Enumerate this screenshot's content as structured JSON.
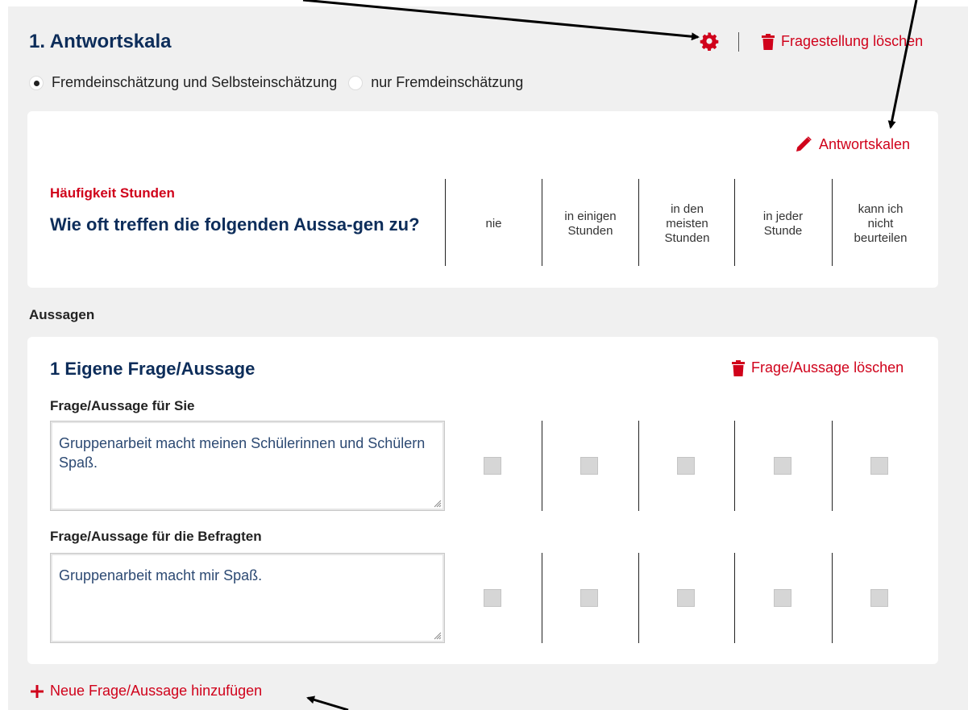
{
  "section": {
    "title": "1. Antwortskala",
    "delete_label": "Fragestellung löschen",
    "radios": [
      {
        "label": "Fremdeinschätzung und Selbsteinschätzung",
        "checked": true
      },
      {
        "label": "nur Fremdeinschätzung",
        "checked": false
      }
    ]
  },
  "scale_card": {
    "edit_label": "Antwortskalen",
    "category": "Häufigkeit Stunden",
    "question": "Wie oft treffen die folgenden Aussa-gen zu?",
    "columns": [
      "nie",
      "in einigen Stunden",
      "in den meisten Stunden",
      "in jeder Stunde",
      "kann ich nicht beurteilen"
    ]
  },
  "statements": {
    "label": "Aussagen",
    "items": [
      {
        "title": "1 Eigene Frage/Aussage",
        "delete_label": "Frage/Aussage löschen",
        "field1_label": "Frage/Aussage für Sie",
        "field1_value": "Gruppenarbeit macht meinen Schülerinnen und Schülern Spaß.",
        "field2_label": "Frage/Aussage für die Befragten",
        "field2_value": "Gruppenarbeit macht mir Spaß."
      }
    ],
    "add_label": "Neue Frage/Aussage hinzufügen"
  },
  "colors": {
    "accent_red": "#d0021b",
    "heading_blue": "#0d2d5a",
    "panel_bg": "#f0f0f0"
  },
  "icons": [
    "gear-icon",
    "trash-icon",
    "pencil-icon",
    "plus-icon",
    "resize-handle-icon"
  ]
}
